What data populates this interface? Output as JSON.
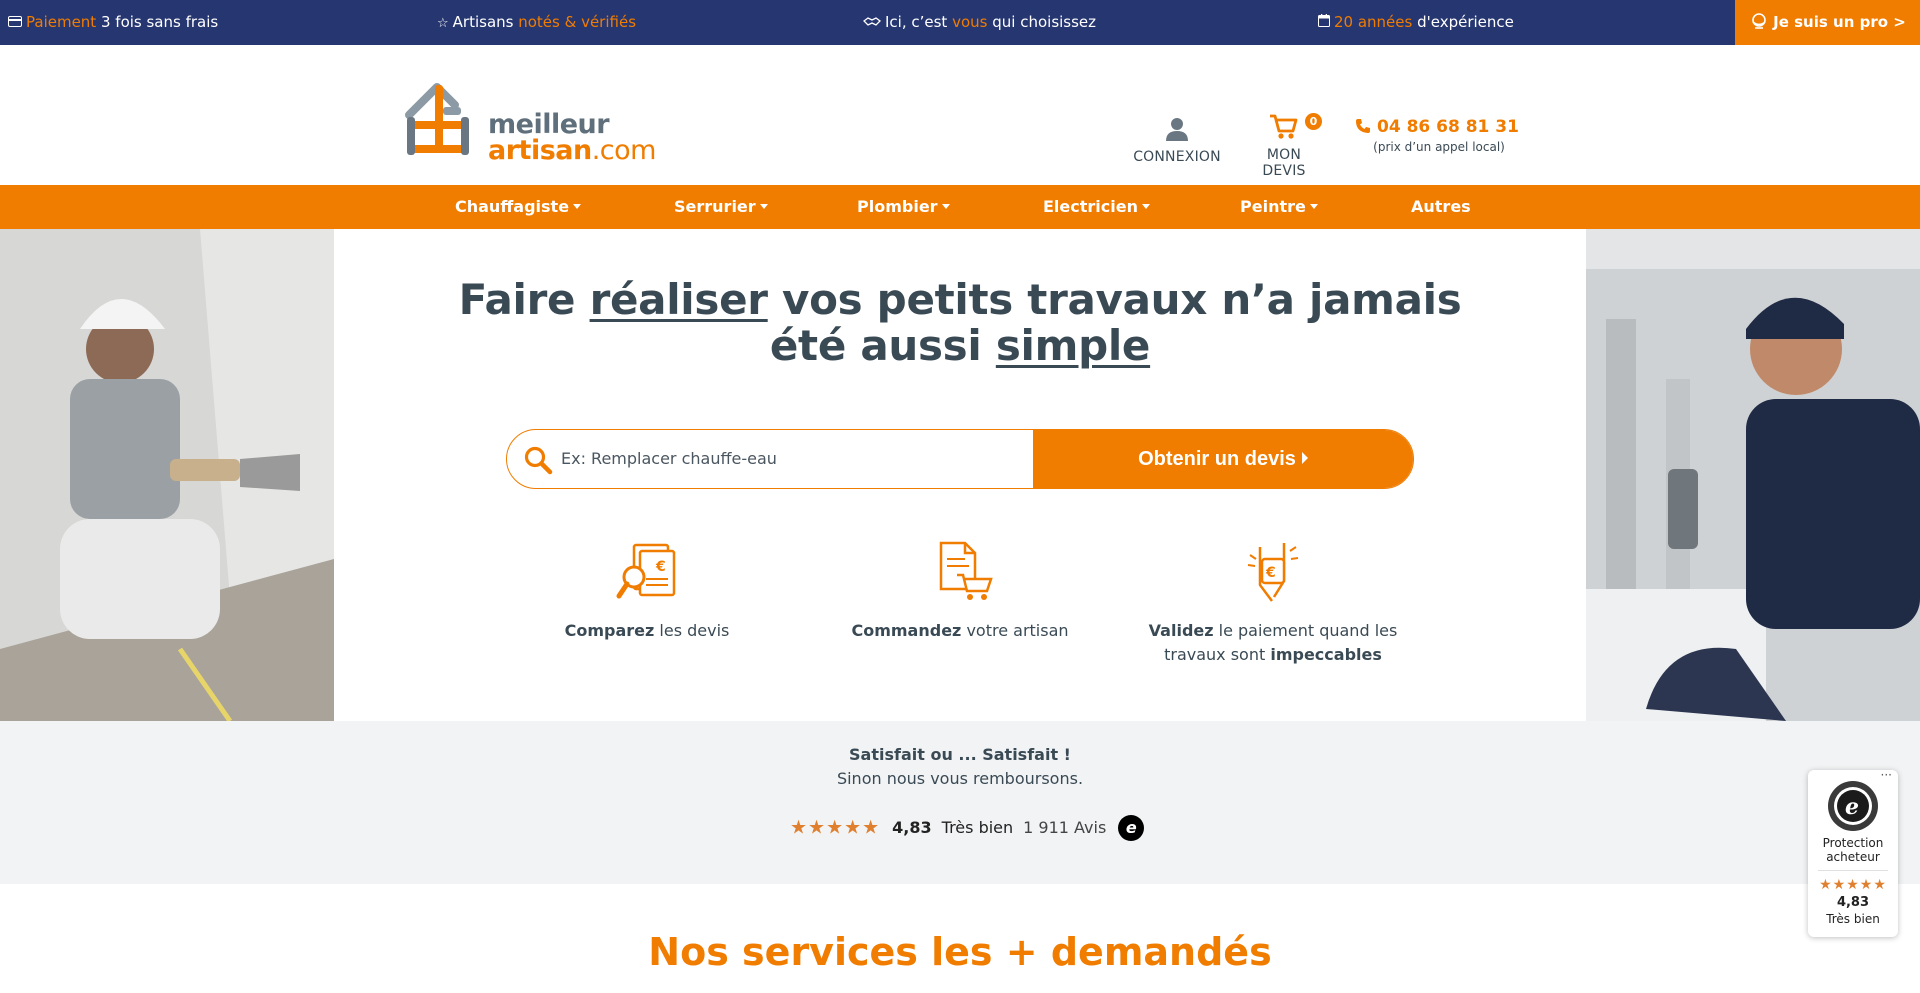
{
  "topbar": {
    "items": [
      {
        "icon": "credit-card-icon",
        "hl": "Paiement",
        "rest": " 3 fois sans frais"
      },
      {
        "icon": "star-icon",
        "pre": "Artisans ",
        "hl": "notés & vérifiés"
      },
      {
        "icon": "handshake-icon",
        "pre": "Ici, c’est ",
        "hl": "vous",
        "post": " qui choisissez"
      },
      {
        "icon": "calendar-icon",
        "hl": "20 années",
        "post": " d'expérience"
      }
    ],
    "pro_label": "Je suis un pro >",
    "colors": {
      "background": "#263670",
      "accent": "#f07c00"
    }
  },
  "header": {
    "logo": {
      "line1": "meilleur",
      "line2": "artisan",
      "tld": ".com"
    },
    "connexion_label": "CONNEXION",
    "devis_label": "MON DEVIS",
    "cart_count": "0",
    "phone": "04 86 68 81 31",
    "phone_note": "(prix d’un appel local)"
  },
  "nav": {
    "items": [
      {
        "label": "Chauffagiste",
        "dropdown": true
      },
      {
        "label": "Serrurier",
        "dropdown": true
      },
      {
        "label": "Plombier",
        "dropdown": true
      },
      {
        "label": "Electricien",
        "dropdown": true
      },
      {
        "label": "Peintre",
        "dropdown": true
      },
      {
        "label": "Autres",
        "dropdown": false
      }
    ]
  },
  "hero": {
    "headline": {
      "a": "Faire ",
      "b": "réaliser",
      "c": " vos petits travaux n’a jamais",
      "d": "été aussi ",
      "e": "simple"
    },
    "search_placeholder": "Ex: Remplacer chauffe-eau",
    "search_button": "Obtenir un devis",
    "steps": [
      {
        "icon": "compare-quotes-icon",
        "bold": "Comparez",
        "rest": " les devis"
      },
      {
        "icon": "order-cart-icon",
        "bold": "Commandez",
        "rest": " votre artisan"
      },
      {
        "icon": "payment-handshake-icon",
        "bold": "Validez",
        "rest": " le paiement quand les travaux sont ",
        "bold2": "impeccables"
      }
    ]
  },
  "guarantee": {
    "title": "Satisfait ou ... Satisfait !",
    "subtitle": "Sinon nous vous remboursons.",
    "stars": "★★★★★",
    "score": "4,83",
    "label": "Très bien",
    "reviews": "1 911 Avis",
    "badge": "e"
  },
  "services_title": "Nos services les + demandés",
  "trusted_widget": {
    "protection": "Protection acheteur",
    "stars": "★★★★★",
    "score": "4,83",
    "label": "Très bien",
    "more": "···"
  }
}
